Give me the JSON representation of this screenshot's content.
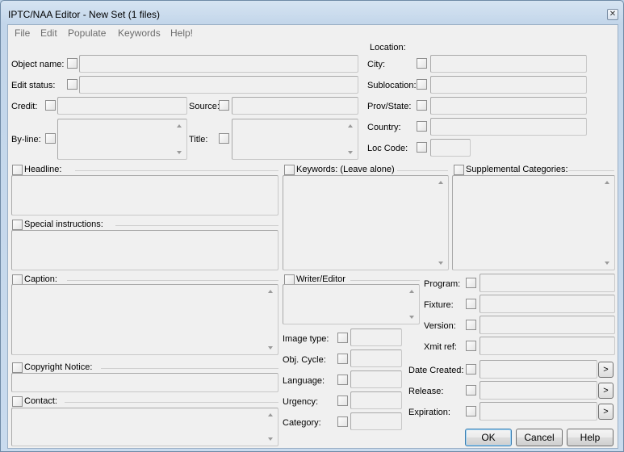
{
  "window": {
    "title": "IPTC/NAA Editor - New Set (1 files)",
    "close_glyph": "✕"
  },
  "menu": [
    "File",
    "Edit",
    "Populate",
    "Keywords",
    "Help!"
  ],
  "fields": {
    "object_name": "Object name:",
    "edit_status": "Edit status:",
    "credit": "Credit:",
    "source": "Source:",
    "byline": "By-line:",
    "title": "Title:",
    "headline": "Headline:",
    "special_instructions": "Special instructions:",
    "caption": "Caption:",
    "copyright_notice": "Copyright Notice:",
    "contact": "Contact:",
    "keywords": "Keywords: (Leave alone)",
    "supplemental_categories": "Supplemental Categories:",
    "writer_editor": "Writer/Editor",
    "image_type": "Image type:",
    "obj_cycle": "Obj. Cycle:",
    "language": "Language:",
    "urgency": "Urgency:",
    "category": "Category:"
  },
  "location": {
    "heading": "Location:",
    "city": "City:",
    "sublocation": "Sublocation:",
    "prov_state": "Prov/State:",
    "country": "Country:",
    "loc_code": "Loc Code:"
  },
  "program": {
    "program": "Program:",
    "fixture": "Fixture:",
    "version": "Version:",
    "xmit_ref": "Xmit ref:"
  },
  "dates": {
    "date_created": "Date Created:",
    "release": "Release:",
    "expiration": "Expiration:",
    "picker_glyph": ">"
  },
  "buttons": {
    "ok": "OK",
    "cancel": "Cancel",
    "help": "Help"
  }
}
